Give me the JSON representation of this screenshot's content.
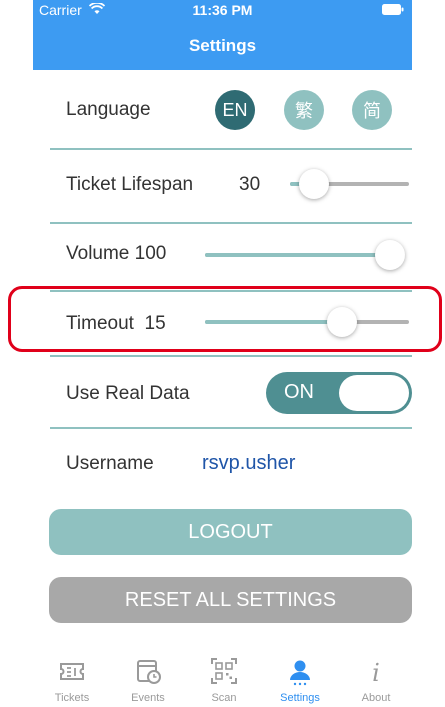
{
  "status": {
    "carrier": "Carrier",
    "time": "11:36 PM"
  },
  "nav": {
    "title": "Settings"
  },
  "language": {
    "label": "Language",
    "options": [
      "EN",
      "繁",
      "简"
    ],
    "selected": "EN"
  },
  "ticket_lifespan": {
    "label": "Ticket Lifespan",
    "value": "30",
    "fraction": 0.1
  },
  "volume": {
    "label": "Volume",
    "value": "100",
    "fraction": 1.0
  },
  "timeout": {
    "label": "Timeout",
    "value": "15",
    "fraction": 0.7
  },
  "real_data": {
    "label": "Use Real Data",
    "toggle_text": "ON"
  },
  "username": {
    "label": "Username",
    "value": "rsvp.usher"
  },
  "buttons": {
    "logout": "LOGOUT",
    "reset": "RESET ALL SETTINGS"
  },
  "colors": {
    "accent": "#8fc1c0",
    "dark_accent": "#2f6b73",
    "nav_blue": "#3d9bf2",
    "highlight": "#e0001a",
    "username": "#1f55a8"
  },
  "tabs": [
    {
      "label": "Tickets",
      "icon": "ticket-icon",
      "active": false
    },
    {
      "label": "Events",
      "icon": "calendar-clock-icon",
      "active": false
    },
    {
      "label": "Scan",
      "icon": "qr-code-icon",
      "active": false
    },
    {
      "label": "Settings",
      "icon": "person-icon",
      "active": true
    },
    {
      "label": "About",
      "icon": "info-icon",
      "active": false
    }
  ]
}
